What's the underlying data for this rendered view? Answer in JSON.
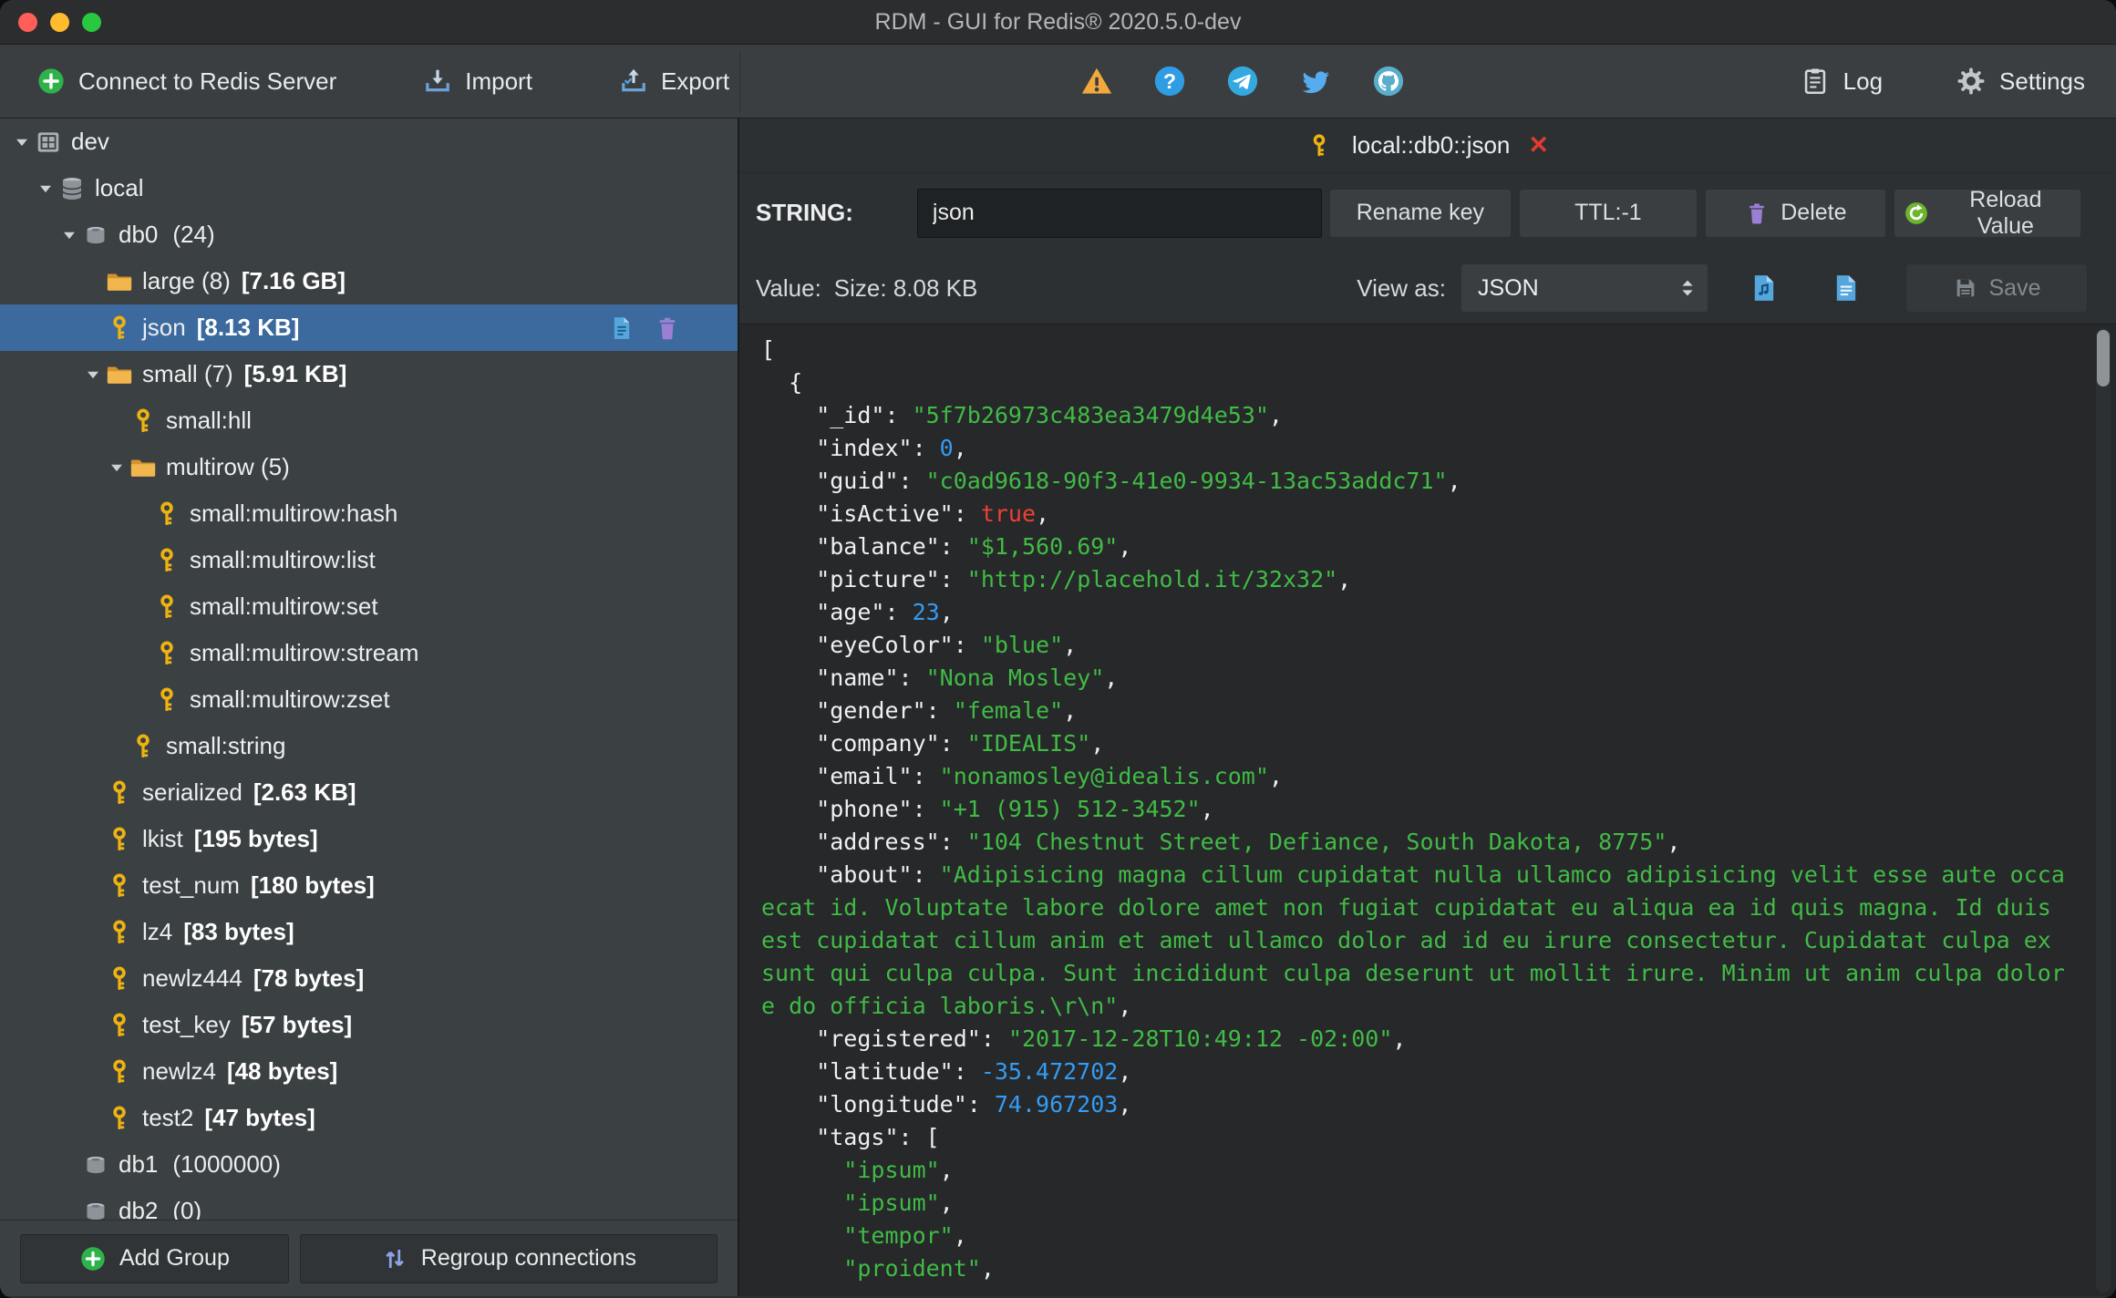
{
  "window": {
    "title": "RDM - GUI for Redis® 2020.5.0-dev"
  },
  "toolbar": {
    "left": [
      {
        "icon": "connect-icon",
        "label": "Connect to Redis Server"
      },
      {
        "icon": "import-icon",
        "label": "Import"
      },
      {
        "icon": "export-icon",
        "label": "Export"
      }
    ],
    "center_icons": [
      "warning-icon",
      "help-icon",
      "telegram-icon",
      "twitter-icon",
      "github-icon"
    ],
    "right": [
      {
        "icon": "log-icon",
        "label": "Log"
      },
      {
        "icon": "settings-icon",
        "label": "Settings"
      }
    ]
  },
  "sidebar": {
    "add_group_label": "Add Group",
    "regroup_label": "Regroup connections",
    "tree": [
      {
        "level": 0,
        "icon": "server",
        "expanded": true,
        "label": "dev"
      },
      {
        "level": 1,
        "icon": "database",
        "expanded": true,
        "label": "local"
      },
      {
        "level": 2,
        "icon": "db",
        "expanded": true,
        "label": "db0",
        "count": "(24)"
      },
      {
        "level": 3,
        "icon": "folder",
        "label": "large (8)",
        "size": "[7.16 GB]"
      },
      {
        "level": 3,
        "icon": "key",
        "label": "json",
        "size": "[8.13 KB]",
        "selected": true,
        "actions": [
          "edit-key-icon",
          "delete-key-icon"
        ]
      },
      {
        "level": 3,
        "icon": "folder",
        "expanded": true,
        "label": "small (7)",
        "size": "[5.91 KB]"
      },
      {
        "level": 4,
        "icon": "key",
        "label": "small:hll"
      },
      {
        "level": 4,
        "icon": "folder",
        "expanded": true,
        "label": "multirow (5)"
      },
      {
        "level": 5,
        "icon": "key",
        "label": "small:multirow:hash"
      },
      {
        "level": 5,
        "icon": "key",
        "label": "small:multirow:list"
      },
      {
        "level": 5,
        "icon": "key",
        "label": "small:multirow:set"
      },
      {
        "level": 5,
        "icon": "key",
        "label": "small:multirow:stream"
      },
      {
        "level": 5,
        "icon": "key",
        "label": "small:multirow:zset"
      },
      {
        "level": 4,
        "icon": "key",
        "label": "small:string"
      },
      {
        "level": 3,
        "icon": "key",
        "label": "serialized",
        "size": "[2.63 KB]"
      },
      {
        "level": 3,
        "icon": "key",
        "label": "lkist",
        "size": "[195 bytes]"
      },
      {
        "level": 3,
        "icon": "key",
        "label": "test_num",
        "size": "[180 bytes]"
      },
      {
        "level": 3,
        "icon": "key",
        "label": "lz4",
        "size": "[83 bytes]"
      },
      {
        "level": 3,
        "icon": "key",
        "label": "newlz444",
        "size": "[78 bytes]"
      },
      {
        "level": 3,
        "icon": "key",
        "label": "test_key",
        "size": "[57 bytes]"
      },
      {
        "level": 3,
        "icon": "key",
        "label": "newlz4",
        "size": "[48 bytes]"
      },
      {
        "level": 3,
        "icon": "key",
        "label": "test2",
        "size": "[47 bytes]"
      },
      {
        "level": 2,
        "icon": "db",
        "label": "db1",
        "count": "(1000000)"
      },
      {
        "level": 2,
        "icon": "db",
        "label": "db2",
        "count": "(0)"
      }
    ]
  },
  "main": {
    "tab": {
      "title": "local::db0::json",
      "icon": "key-icon",
      "close_icon": "close-icon"
    },
    "key_row": {
      "type_label": "STRING:",
      "key_name": "json",
      "rename_label": "Rename key",
      "ttl_label": "TTL:-1",
      "delete_label": "Delete",
      "reload_label": "Reload Value"
    },
    "value_row": {
      "value_label": "Value:",
      "size_label": "Size: 8.08 KB",
      "view_as_label": "View as:",
      "view_as_value": "JSON",
      "save_label": "Save"
    },
    "editor": {
      "lines": [
        [
          [
            "w",
            "["
          ]
        ],
        [
          [
            "w",
            "  {"
          ]
        ],
        [
          [
            "w",
            "    \"_id\": "
          ],
          [
            "g",
            "\"5f7b26973c483ea3479d4e53\""
          ],
          [
            "w",
            ","
          ]
        ],
        [
          [
            "w",
            "    \"index\": "
          ],
          [
            "b",
            "0"
          ],
          [
            "w",
            ","
          ]
        ],
        [
          [
            "w",
            "    \"guid\": "
          ],
          [
            "g",
            "\"c0ad9618-90f3-41e0-9934-13ac53addc71\""
          ],
          [
            "w",
            ","
          ]
        ],
        [
          [
            "w",
            "    \"isActive\": "
          ],
          [
            "r",
            "true"
          ],
          [
            "w",
            ","
          ]
        ],
        [
          [
            "w",
            "    \"balance\": "
          ],
          [
            "g",
            "\"$1,560.69\""
          ],
          [
            "w",
            ","
          ]
        ],
        [
          [
            "w",
            "    \"picture\": "
          ],
          [
            "g",
            "\"http://placehold.it/32x32\""
          ],
          [
            "w",
            ","
          ]
        ],
        [
          [
            "w",
            "    \"age\": "
          ],
          [
            "b",
            "23"
          ],
          [
            "w",
            ","
          ]
        ],
        [
          [
            "w",
            "    \"eyeColor\": "
          ],
          [
            "g",
            "\"blue\""
          ],
          [
            "w",
            ","
          ]
        ],
        [
          [
            "w",
            "    \"name\": "
          ],
          [
            "g",
            "\"Nona Mosley\""
          ],
          [
            "w",
            ","
          ]
        ],
        [
          [
            "w",
            "    \"gender\": "
          ],
          [
            "g",
            "\"female\""
          ],
          [
            "w",
            ","
          ]
        ],
        [
          [
            "w",
            "    \"company\": "
          ],
          [
            "g",
            "\"IDEALIS\""
          ],
          [
            "w",
            ","
          ]
        ],
        [
          [
            "w",
            "    \"email\": "
          ],
          [
            "g",
            "\"nonamosley@idealis.com\""
          ],
          [
            "w",
            ","
          ]
        ],
        [
          [
            "w",
            "    \"phone\": "
          ],
          [
            "g",
            "\"+1 (915) 512-3452\""
          ],
          [
            "w",
            ","
          ]
        ],
        [
          [
            "w",
            "    \"address\": "
          ],
          [
            "g",
            "\"104 Chestnut Street, Defiance, South Dakota, 8775\""
          ],
          [
            "w",
            ","
          ]
        ],
        [
          [
            "w",
            "    \"about\": "
          ],
          [
            "g",
            "\"Adipisicing magna cillum cupidatat nulla ullamco adipisicing velit esse aute occa"
          ]
        ],
        [
          [
            "g",
            "ecat id. Voluptate labore dolore amet non fugiat cupidatat eu aliqua ea id quis magna. Id duis"
          ]
        ],
        [
          [
            "g",
            "est cupidatat cillum anim et amet ullamco dolor ad id eu irure consectetur. Cupidatat culpa ex"
          ]
        ],
        [
          [
            "g",
            "sunt qui culpa culpa. Sunt incididunt culpa deserunt ut mollit irure. Minim ut anim culpa dolor"
          ]
        ],
        [
          [
            "g",
            "e do officia laboris.\\r\\n\""
          ],
          [
            "w",
            ","
          ]
        ],
        [
          [
            "w",
            "    \"registered\": "
          ],
          [
            "g",
            "\"2017-12-28T10:49:12 -02:00\""
          ],
          [
            "w",
            ","
          ]
        ],
        [
          [
            "w",
            "    \"latitude\": "
          ],
          [
            "b",
            "-35.472702"
          ],
          [
            "w",
            ","
          ]
        ],
        [
          [
            "w",
            "    \"longitude\": "
          ],
          [
            "b",
            "74.967203"
          ],
          [
            "w",
            ","
          ]
        ],
        [
          [
            "w",
            "    \"tags\": ["
          ]
        ],
        [
          [
            "g",
            "      \"ipsum\""
          ],
          [
            "w",
            ","
          ]
        ],
        [
          [
            "g",
            "      \"ipsum\""
          ],
          [
            "w",
            ","
          ]
        ],
        [
          [
            "g",
            "      \"tempor\""
          ],
          [
            "w",
            ","
          ]
        ],
        [
          [
            "g",
            "      \"proident\""
          ],
          [
            "w",
            ","
          ]
        ]
      ]
    }
  },
  "colors": {
    "selection_blue": "#3c6a9e",
    "json_string_green": "#41bb45",
    "json_number_blue": "#349cf4",
    "json_bool_red": "#ee4035",
    "key_gold": "#eeb211",
    "folder_yellow": "#d4922a",
    "folder_yellow_light": "#f1b64e",
    "connect_green": "#2eb34a",
    "reload_green": "#6cb52d",
    "trash_purple": "#9a7fd4",
    "warning_orange": "#f2a93b",
    "help_blue": "#2f9de4",
    "telegram_blue": "#34a9e0",
    "twitter_blue": "#55acee",
    "github_blue": "#58aecb",
    "doc_blue": "#54a6dd",
    "close_red": "#e23b30",
    "regroup_blue": "#8fa3e8",
    "mac_red": "#ff5f57",
    "mac_yellow": "#febc2e",
    "mac_green": "#28c840"
  }
}
